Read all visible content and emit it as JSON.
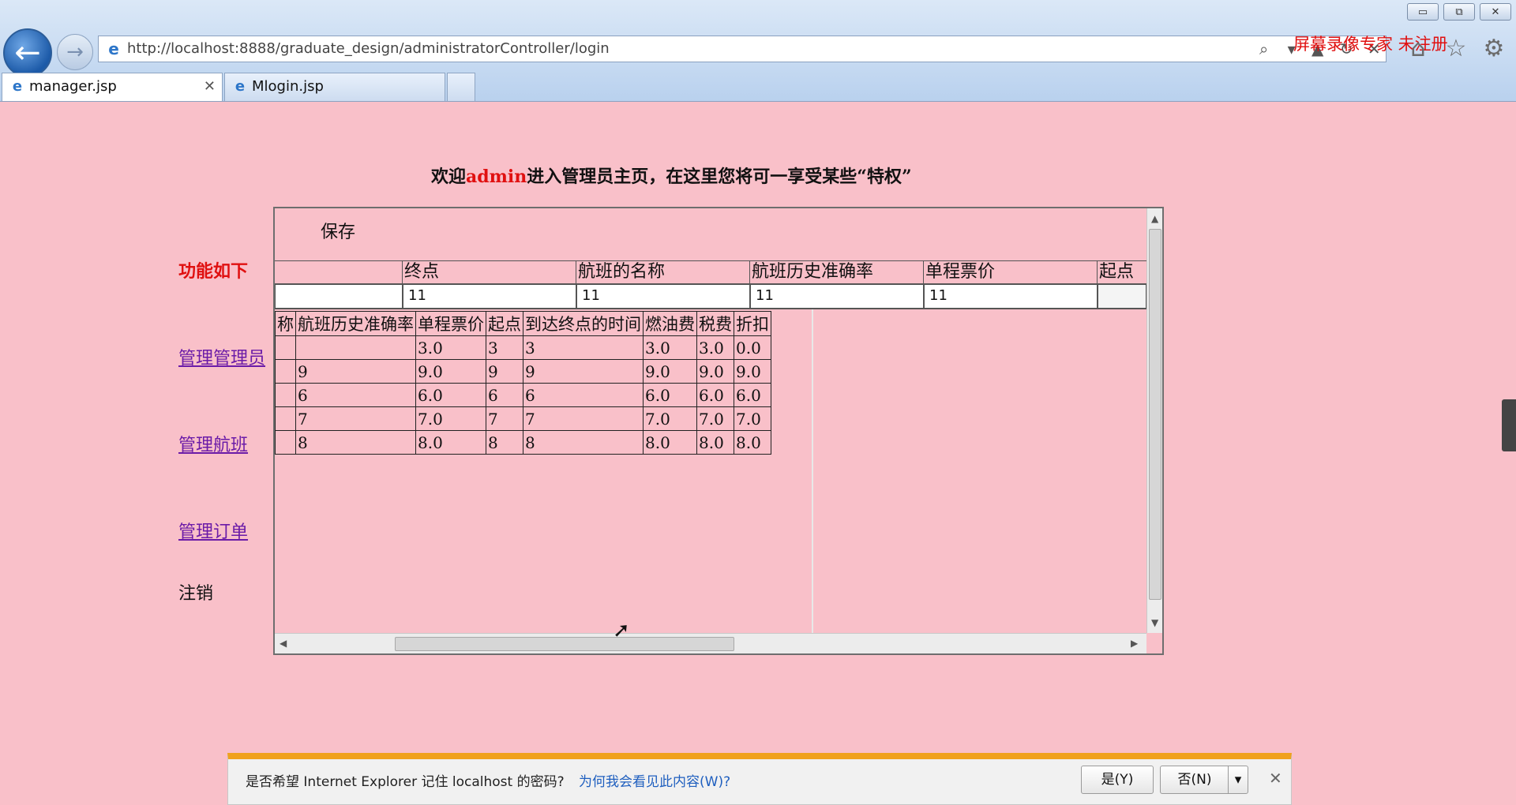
{
  "browser": {
    "url": "http://localhost:8888/graduate_design/administratorController/login",
    "watermark": "屏幕录像专家 未注册",
    "window_buttons": [
      "▭",
      "⧉",
      "✕"
    ],
    "tabs": [
      {
        "label": "manager.jsp",
        "active": true,
        "close": "✕"
      },
      {
        "label": "Mlogin.jsp",
        "active": false
      }
    ],
    "icons": [
      "back-icon",
      "forward-icon",
      "ie-icon",
      "search-icon",
      "refresh-icon",
      "stop-icon",
      "home-icon",
      "favorites-icon",
      "settings-icon"
    ]
  },
  "page": {
    "welcome": {
      "prefix": "欢迎",
      "user": "admin",
      "suffix": "进入管理员主页，在这里您将可一享受某些“特权”"
    },
    "function_title": "功能如下",
    "nav": [
      {
        "label": "管理管理员"
      },
      {
        "label": "管理航班"
      },
      {
        "label": "管理订单"
      }
    ],
    "logout": "注销"
  },
  "panel": {
    "save_label": "保存",
    "edit_headers": [
      "",
      "终点",
      "航班的名称",
      "航班历史准确率",
      "单程票价",
      "起点"
    ],
    "edit_values": [
      "",
      "11",
      "11",
      "11",
      "11",
      ""
    ],
    "table": {
      "headers": [
        "称",
        "航班历史准确率",
        "单程票价",
        "起点",
        "到达终点的时间",
        "燃油费",
        "税费",
        "折扣"
      ],
      "rows": [
        [
          "",
          "",
          "3.0",
          "3",
          "3",
          "3.0",
          "3.0",
          "0.0"
        ],
        [
          "",
          "9",
          "9.0",
          "9",
          "9",
          "9.0",
          "9.0",
          "9.0"
        ],
        [
          "",
          "6",
          "6.0",
          "6",
          "6",
          "6.0",
          "6.0",
          "6.0"
        ],
        [
          "",
          "7",
          "7.0",
          "7",
          "7",
          "7.0",
          "7.0",
          "7.0"
        ],
        [
          "",
          "8",
          "8.0",
          "8",
          "8",
          "8.0",
          "8.0",
          "8.0"
        ]
      ]
    }
  },
  "notification": {
    "text": "是否希望 Internet Explorer 记住 localhost 的密码?",
    "link": "为何我会看见此内容(W)?",
    "yes": "是(Y)",
    "no": "否(N)",
    "close": "✕"
  },
  "colors": {
    "page_bg": "#f9c0c9",
    "accent_red": "#e01010",
    "link_visited": "#6b1ba8",
    "notif_stripe": "#f0a11d"
  }
}
